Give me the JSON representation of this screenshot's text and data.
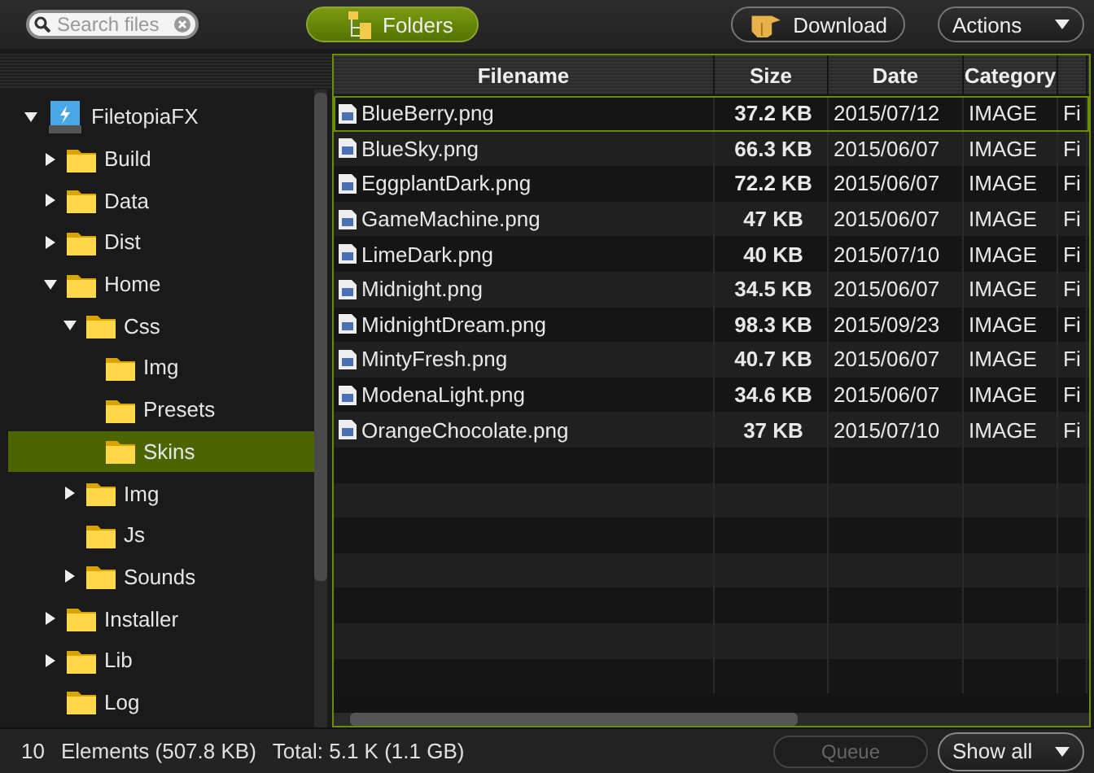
{
  "toolbar": {
    "search": {
      "placeholder": "Search files"
    },
    "folders_button": {
      "label": "Folders"
    },
    "download_button": {
      "label": "Download"
    },
    "actions_menu": {
      "label": "Actions"
    }
  },
  "tree": [
    {
      "label": "FiletopiaFX",
      "kind": "drive",
      "expanded": true,
      "selected": false,
      "children": [
        {
          "label": "Build",
          "kind": "folder",
          "expanded": false,
          "selected": false
        },
        {
          "label": "Data",
          "kind": "folder",
          "expanded": false,
          "selected": false
        },
        {
          "label": "Dist",
          "kind": "folder",
          "expanded": false,
          "selected": false
        },
        {
          "label": "Home",
          "kind": "folder",
          "expanded": true,
          "selected": false,
          "children": [
            {
              "label": "Css",
              "kind": "folder",
              "expanded": true,
              "selected": false,
              "children": [
                {
                  "label": "Img",
                  "kind": "leaf",
                  "selected": false
                },
                {
                  "label": "Presets",
                  "kind": "leaf",
                  "selected": false
                },
                {
                  "label": "Skins",
                  "kind": "leaf",
                  "selected": true
                }
              ]
            },
            {
              "label": "Img",
              "kind": "folder",
              "expanded": false,
              "selected": false
            },
            {
              "label": "Js",
              "kind": "leaf",
              "selected": false
            },
            {
              "label": "Sounds",
              "kind": "folder",
              "expanded": false,
              "selected": false
            }
          ]
        },
        {
          "label": "Installer",
          "kind": "folder",
          "expanded": false,
          "selected": false
        },
        {
          "label": "Lib",
          "kind": "folder",
          "expanded": false,
          "selected": false
        },
        {
          "label": "Log",
          "kind": "leaf",
          "selected": false
        }
      ]
    }
  ],
  "table": {
    "columns": [
      "Filename",
      "Size",
      "Date",
      "Category"
    ],
    "rows": [
      {
        "filename": "BlueBerry.png",
        "size": "37.2 KB",
        "date": "2015/07/12",
        "category": "IMAGE",
        "column_5": "Fi",
        "selected": true
      },
      {
        "filename": "BlueSky.png",
        "size": "66.3 KB",
        "date": "2015/06/07",
        "category": "IMAGE",
        "column_5": "Fi",
        "selected": false
      },
      {
        "filename": "EggplantDark.png",
        "size": "72.2 KB",
        "date": "2015/06/07",
        "category": "IMAGE",
        "column_5": "Fi",
        "selected": false
      },
      {
        "filename": "GameMachine.png",
        "size": "47 KB",
        "date": "2015/06/07",
        "category": "IMAGE",
        "column_5": "Fi",
        "selected": false
      },
      {
        "filename": "LimeDark.png",
        "size": "40 KB",
        "date": "2015/07/10",
        "category": "IMAGE",
        "column_5": "Fi",
        "selected": false
      },
      {
        "filename": "Midnight.png",
        "size": "34.5 KB",
        "date": "2015/06/07",
        "category": "IMAGE",
        "column_5": "Fi",
        "selected": false
      },
      {
        "filename": "MidnightDream.png",
        "size": "98.3 KB",
        "date": "2015/09/23",
        "category": "IMAGE",
        "column_5": "Fi",
        "selected": false
      },
      {
        "filename": "MintyFresh.png",
        "size": "40.7 KB",
        "date": "2015/06/07",
        "category": "IMAGE",
        "column_5": "Fi",
        "selected": false
      },
      {
        "filename": "ModenaLight.png",
        "size": "34.6 KB",
        "date": "2015/06/07",
        "category": "IMAGE",
        "column_5": "Fi",
        "selected": false
      },
      {
        "filename": "OrangeChocolate.png",
        "size": "37 KB",
        "date": "2015/07/10",
        "category": "IMAGE",
        "column_5": "Fi",
        "selected": false
      }
    ]
  },
  "status_bar": {
    "count": "10",
    "elements": "Elements (507.8 KB)",
    "total": "Total: 5.1 K (1.1 GB)",
    "queue_button": {
      "label": "Queue",
      "disabled": true
    },
    "filter": {
      "value": "Show all"
    }
  }
}
